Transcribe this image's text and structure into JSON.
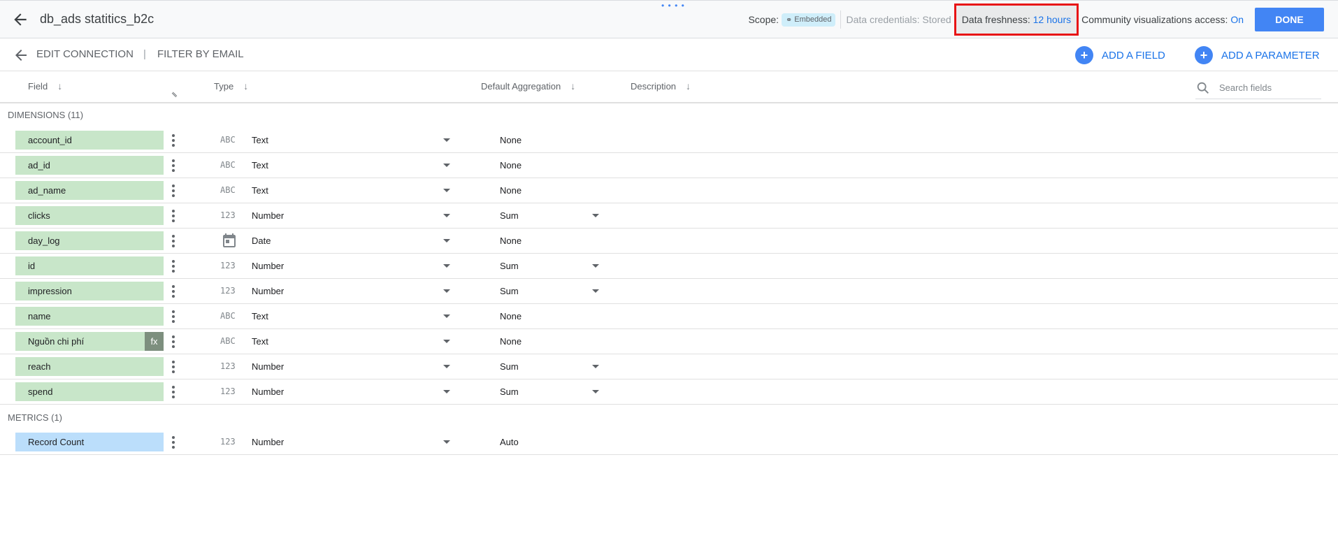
{
  "header": {
    "title": "db_ads statitics_b2c",
    "scope_label": "Scope:",
    "scope_value": "Embedded",
    "credentials": "Data credentials: Stored",
    "freshness_label": "Data freshness:",
    "freshness_value": "12 hours",
    "community_label": "Community visualizations access:",
    "community_value": "On",
    "done_label": "DONE"
  },
  "toolbar": {
    "edit_connection": "EDIT CONNECTION",
    "pipe": "|",
    "filter_by_email": "FILTER BY EMAIL",
    "add_field": "ADD A FIELD",
    "add_parameter": "ADD A PARAMETER"
  },
  "columns": {
    "field": "Field",
    "type": "Type",
    "aggregation": "Default Aggregation",
    "description": "Description"
  },
  "search": {
    "placeholder": "Search fields"
  },
  "dimensions": {
    "label": "DIMENSIONS (11)",
    "rows": [
      {
        "name": "account_id",
        "type_icon": "ABC",
        "type": "Text",
        "agg": "None",
        "agg_dd": false,
        "fx": ""
      },
      {
        "name": "ad_id",
        "type_icon": "ABC",
        "type": "Text",
        "agg": "None",
        "agg_dd": false,
        "fx": ""
      },
      {
        "name": "ad_name",
        "type_icon": "ABC",
        "type": "Text",
        "agg": "None",
        "agg_dd": false,
        "fx": ""
      },
      {
        "name": "clicks",
        "type_icon": "123",
        "type": "Number",
        "agg": "Sum",
        "agg_dd": true,
        "fx": ""
      },
      {
        "name": "day_log",
        "type_icon": "calendar",
        "type": "Date",
        "agg": "None",
        "agg_dd": false,
        "fx": ""
      },
      {
        "name": "id",
        "type_icon": "123",
        "type": "Number",
        "agg": "Sum",
        "agg_dd": true,
        "fx": ""
      },
      {
        "name": "impression",
        "type_icon": "123",
        "type": "Number",
        "agg": "Sum",
        "agg_dd": true,
        "fx": ""
      },
      {
        "name": "name",
        "type_icon": "ABC",
        "type": "Text",
        "agg": "None",
        "agg_dd": false,
        "fx": ""
      },
      {
        "name": "Nguồn chi phí",
        "type_icon": "ABC",
        "type": "Text",
        "agg": "None",
        "agg_dd": false,
        "fx": "fx"
      },
      {
        "name": "reach",
        "type_icon": "123",
        "type": "Number",
        "agg": "Sum",
        "agg_dd": true,
        "fx": ""
      },
      {
        "name": "spend",
        "type_icon": "123",
        "type": "Number",
        "agg": "Sum",
        "agg_dd": true,
        "fx": ""
      }
    ]
  },
  "metrics": {
    "label": "METRICS (1)",
    "rows": [
      {
        "name": "Record Count",
        "type_icon": "123",
        "type": "Number",
        "agg": "Auto",
        "agg_dd": false,
        "fx": ""
      }
    ]
  },
  "colors": {
    "accent": "#4285f4",
    "dimension_chip": "#c8e6c9",
    "metric_chip": "#bbdefb",
    "highlight_box": "#e81416"
  }
}
